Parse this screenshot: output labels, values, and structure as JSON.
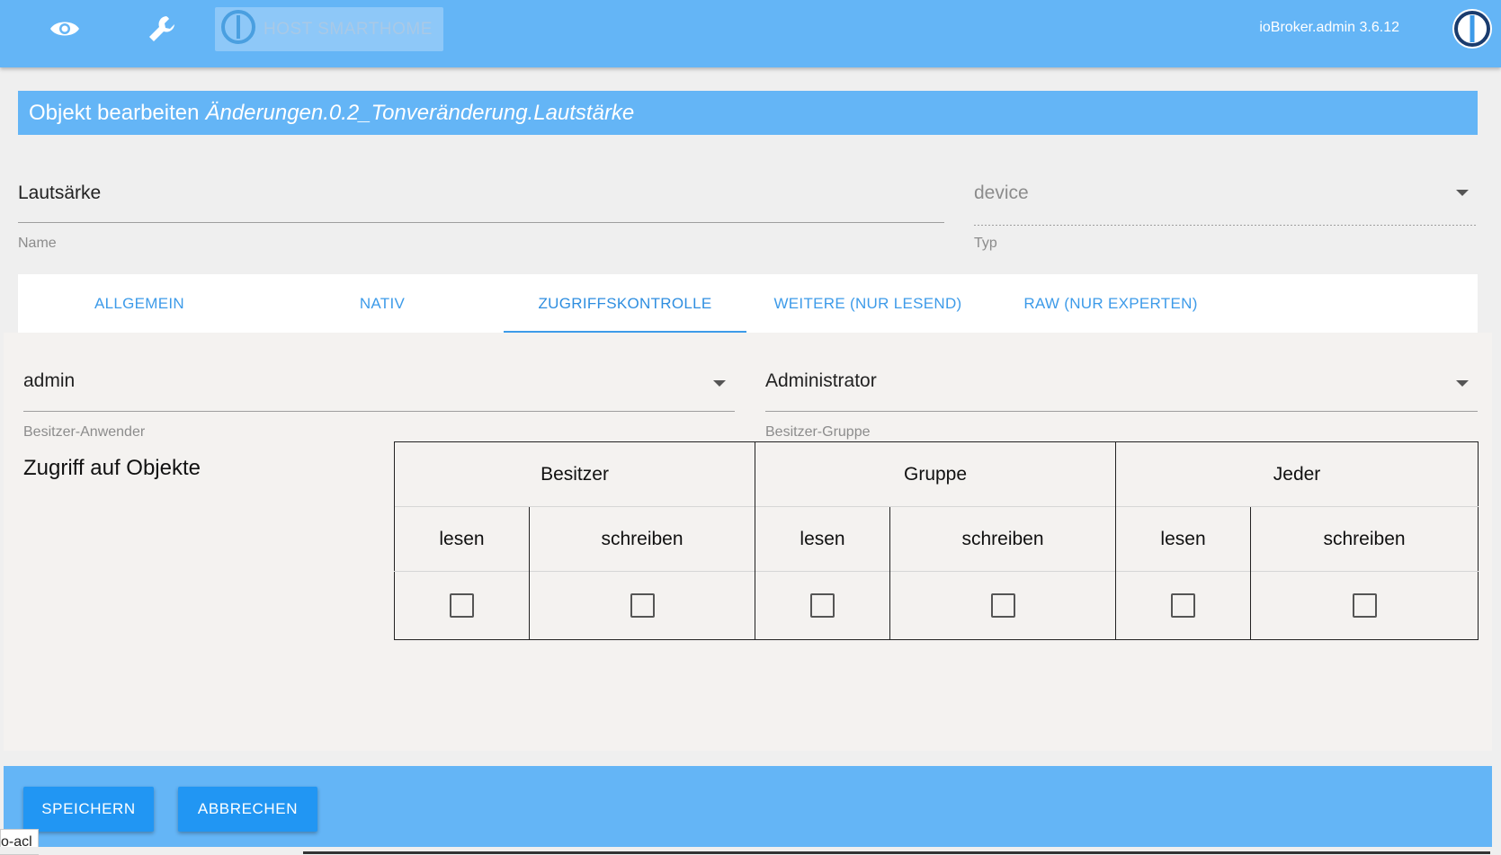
{
  "header": {
    "host_label": "HOST SMARTHOME",
    "version": "ioBroker.admin 3.6.12",
    "icons": [
      "eye-icon",
      "wrench-icon",
      "iobroker-logo-icon"
    ]
  },
  "dialog": {
    "title_prefix": "Objekt bearbeiten",
    "title_path": "Änderungen.0.2_Tonveränderung.Lautstärke"
  },
  "name_field": {
    "value": "Lautsärke",
    "label": "Name"
  },
  "type_field": {
    "value": "device",
    "label": "Typ"
  },
  "tabs": [
    {
      "label": "ALLGEMEIN",
      "active": false
    },
    {
      "label": "NATIV",
      "active": false
    },
    {
      "label": "ZUGRIFFSKONTROLLE",
      "active": true
    },
    {
      "label": "WEITERE (NUR LESEND)",
      "active": false
    },
    {
      "label": "RAW (NUR EXPERTEN)",
      "active": false
    }
  ],
  "owner_user": {
    "value": "admin",
    "label": "Besitzer-Anwender"
  },
  "owner_group": {
    "value": "Administrator",
    "label": "Besitzer-Gruppe"
  },
  "acl": {
    "heading": "Zugriff auf Objekte",
    "groups": [
      "Besitzer",
      "Gruppe",
      "Jeder"
    ],
    "perms": [
      "lesen",
      "schreiben"
    ],
    "checked": [
      false,
      false,
      false,
      false,
      false,
      false
    ]
  },
  "footer": {
    "save_label": "SPEICHERN",
    "cancel_label": "ABBRECHEN"
  },
  "status_chip": "o-acl",
  "colors": {
    "primary": "#64b5f6",
    "button": "#2196f3",
    "tab_text": "#3d9be9"
  }
}
